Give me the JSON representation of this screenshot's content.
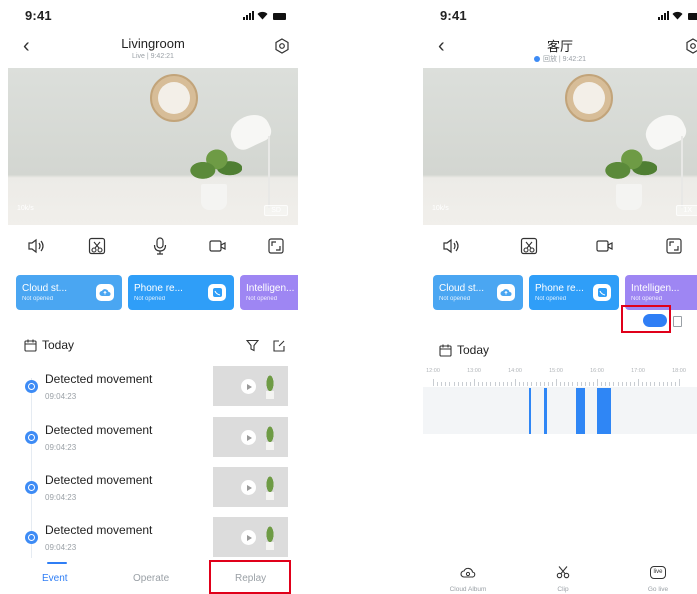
{
  "status_bar": {
    "time": "9:41"
  },
  "live_screen": {
    "title": "Livingroom",
    "subtitle": "Live | 9:42:21",
    "video": {
      "bitrate": "10k/s",
      "quality": "SD"
    },
    "controls": [
      "speaker-icon",
      "scissors-icon",
      "microphone-icon",
      "record-icon",
      "fullscreen-icon"
    ],
    "cards": [
      {
        "label": "Cloud st...",
        "status": "Not opened",
        "icon": "cloud-icon"
      },
      {
        "label": "Phone re...",
        "status": "Not opened",
        "icon": "phone-icon"
      },
      {
        "label": "Intelligen...",
        "status": "Not opened",
        "icon": "ai-badge",
        "badge": "Ai"
      }
    ],
    "date_label": "Today",
    "events": [
      {
        "title": "Detected movement",
        "time": "09:04:23"
      },
      {
        "title": "Detected movement",
        "time": "09:04:23"
      },
      {
        "title": "Detected movement",
        "time": "09:04:23"
      },
      {
        "title": "Detected movement",
        "time": "09:04:23"
      }
    ],
    "tabs": [
      {
        "label": "Event",
        "active": true
      },
      {
        "label": "Operate",
        "active": false
      },
      {
        "label": "Replay",
        "active": false,
        "highlighted": true
      }
    ]
  },
  "replay_screen": {
    "title": "客厅",
    "subtitle": "回放 | 9:42:21",
    "video": {
      "bitrate": "10k/s",
      "speed": "1X"
    },
    "controls": [
      "speaker-icon",
      "scissors-icon",
      "record-icon",
      "fullscreen-icon"
    ],
    "cards": [
      {
        "label": "Cloud st...",
        "status": "Not opened",
        "icon": "cloud-icon"
      },
      {
        "label": "Phone re...",
        "status": "Not opened",
        "icon": "phone-icon"
      },
      {
        "label": "Intelligen...",
        "status": "Not opened",
        "icon": "ai-badge",
        "badge": "Ai"
      }
    ],
    "date_label": "Today",
    "timeline": {
      "hour_labels": [
        "12:00",
        "13:00",
        "14:00",
        "15:00",
        "16:00",
        "17:00",
        "18:00"
      ],
      "recording_segments": [
        {
          "start": "14:20",
          "end": "14:22"
        },
        {
          "start": "14:42",
          "end": "14:47"
        },
        {
          "start": "15:29",
          "end": "15:43"
        },
        {
          "start": "16:00",
          "end": "16:20"
        }
      ]
    },
    "bottom_nav": [
      {
        "label": "Cloud Album",
        "icon": "cloud-album-icon"
      },
      {
        "label": "Clip",
        "icon": "scissors-icon"
      },
      {
        "label": "Go live",
        "icon": "live-icon",
        "badge": "live"
      }
    ]
  },
  "colors": {
    "accent": "#2f7ef5",
    "highlight_box": "#e0001a",
    "card_cloud": "#4aa6f2",
    "card_phone": "#2f9ef8",
    "card_ai": "#9e86f3"
  }
}
